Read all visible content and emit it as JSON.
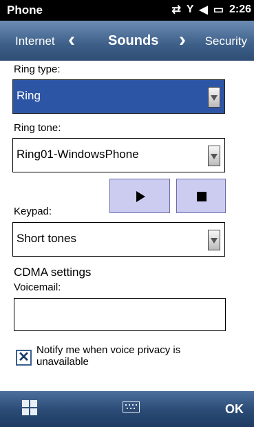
{
  "status_bar": {
    "app_name": "Phone",
    "time": "2:26",
    "icons": [
      "data-sync-icon",
      "signal-icon",
      "volume-icon",
      "battery-icon"
    ]
  },
  "tabs": {
    "previous": "Internet",
    "current": "Sounds",
    "next": "Security"
  },
  "ring_type": {
    "label": "Ring type:",
    "value": "Ring",
    "selected": true
  },
  "ring_tone": {
    "label": "Ring tone:",
    "value": "Ring01-WindowsPhone"
  },
  "keypad": {
    "label": "Keypad:",
    "value": "Short tones"
  },
  "cdma": {
    "heading": "CDMA settings",
    "voicemail_label": "Voicemail:",
    "voicemail_value": ""
  },
  "voice_privacy": {
    "label": "Notify me when voice privacy is unavailable",
    "checked": true
  },
  "bottom_bar": {
    "ok_label": "OK"
  },
  "colors": {
    "selected_field": "#2d55a5",
    "play_stop_buttons": "#ccccf0",
    "tab_bar": "#3d5f88"
  }
}
